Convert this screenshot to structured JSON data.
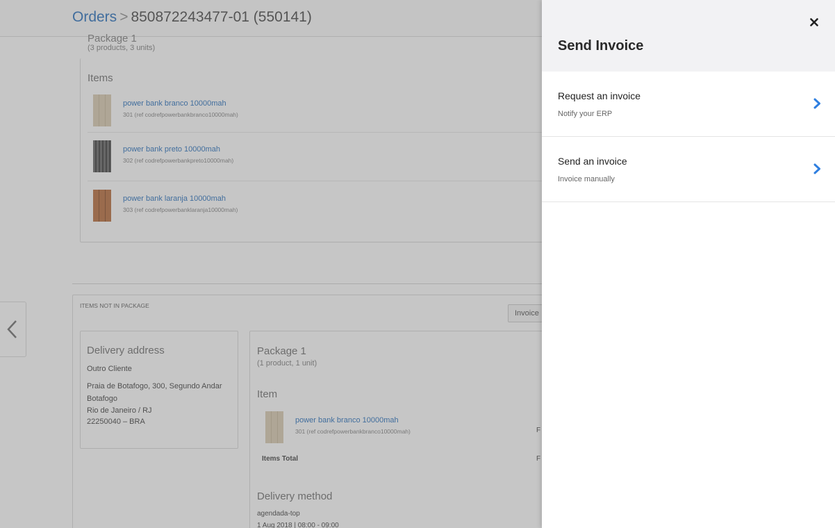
{
  "header": {
    "breadcrumb_root": "Orders",
    "separator": ">",
    "order_title": "850872243477-01 (550141)"
  },
  "package_top": {
    "partial_title": "Package 1",
    "summary": "(3 products, 3 units)",
    "items_heading": "Items",
    "items": [
      {
        "name": "power bank branco 10000mah",
        "ref": "301 (ref codrefpowerbankbranco10000mah)",
        "image": "beige-folding-screen"
      },
      {
        "name": "power bank preto 10000mah",
        "ref": "302 (ref codrefpowerbankpreto10000mah)",
        "image": "black-folding-screen"
      },
      {
        "name": "power bank laranja 10000mah",
        "ref": "303 (ref codrefpowerbanklaranja10000mah)",
        "image": "orange-folding-screen"
      }
    ]
  },
  "items_not_in_package": {
    "label": "ITEMS NOT IN PACKAGE",
    "invoice_button": "Invoice"
  },
  "delivery_address": {
    "heading": "Delivery address",
    "name": "Outro Cliente",
    "line1": "Praia de Botafogo, 300, Segundo Andar",
    "line2": "Botafogo",
    "line3": "Rio de Janeiro / RJ",
    "line4": "22250040 – BRA"
  },
  "package_1": {
    "heading": "Package 1",
    "summary": "(1 product, 1 unit)",
    "item_heading": "Item",
    "item": {
      "name": "power bank branco 10000mah",
      "ref": "301 (ref codrefpowerbankbranco10000mah)",
      "price_partial": "F"
    },
    "items_total_label": "Items Total",
    "items_total_partial": "F",
    "delivery_method_heading": "Delivery method",
    "delivery_method": "agendada-top",
    "delivery_window": "1 Aug 2018 | 08:00 - 09:00"
  },
  "nav": {
    "back_icon": "chevron-left-icon"
  },
  "drawer": {
    "title": "Send Invoice",
    "close_icon": "close-icon",
    "options": [
      {
        "title": "Request an invoice",
        "subtitle": "Notify your ERP",
        "icon": "chevron-right-icon"
      },
      {
        "title": "Send an invoice",
        "subtitle": "Invoice manually",
        "icon": "chevron-right-icon"
      }
    ]
  },
  "colors": {
    "accent": "#2f7fe0",
    "link": "#1a67b8",
    "overlay": "#7a7a7a",
    "drawer_header": "#f2f2f4"
  }
}
